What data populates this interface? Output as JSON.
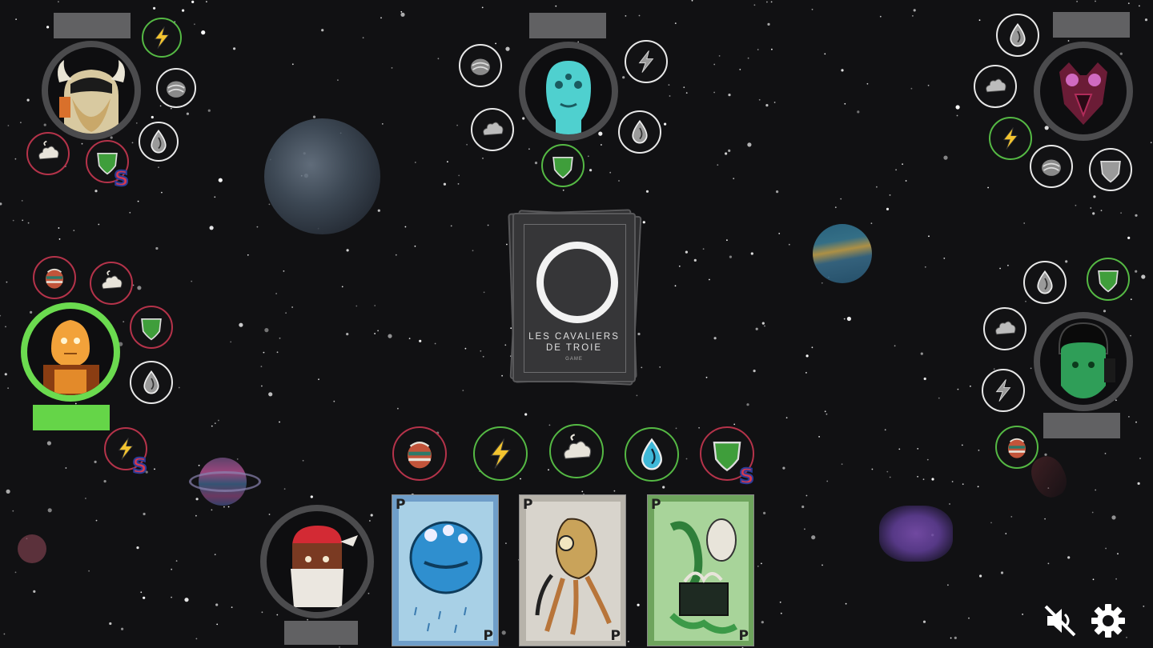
{
  "deck": {
    "title": "LES CAVALIERS\nDE TROIE",
    "subtitle": "GAME"
  },
  "hand_cards": [
    {
      "name": "blue-pufferfish-card",
      "corner_letter": "P",
      "color": "#6f9ec9"
    },
    {
      "name": "gray-creature-card",
      "corner_letter": "P",
      "color": "#b7b3aa"
    },
    {
      "name": "green-creature-card",
      "corner_letter": "P",
      "color": "#6ea45d"
    }
  ],
  "hand_resources": [
    {
      "name": "ore-resource",
      "icon": "ore-icon",
      "ring": "red"
    },
    {
      "name": "lightning-resource",
      "icon": "lightning-icon",
      "ring": "green"
    },
    {
      "name": "cloud-resource",
      "icon": "cloud-icon",
      "ring": "green"
    },
    {
      "name": "water-resource",
      "icon": "water-icon",
      "ring": "green"
    },
    {
      "name": "shield-resource",
      "icon": "shield-icon",
      "ring": "red",
      "badge": "S"
    }
  ],
  "colors": {
    "active_ring": "#6bdb4f",
    "inactive_ring": "#4b4b4d",
    "token_green": "#55b944",
    "token_red": "#b5334a",
    "token_white": "#e8e8e8",
    "background": "#111113"
  },
  "controls": {
    "mute_icon": "speaker-muted-icon",
    "settings_icon": "gear-icon"
  },
  "players": [
    {
      "name": "player-viking",
      "active": false
    },
    {
      "name": "player-cyan-alien",
      "active": false
    },
    {
      "name": "player-horned-demon",
      "active": false
    },
    {
      "name": "player-orange-robot",
      "active": true
    },
    {
      "name": "player-green-alien",
      "active": false
    },
    {
      "name": "player-ninja",
      "active": false
    }
  ]
}
